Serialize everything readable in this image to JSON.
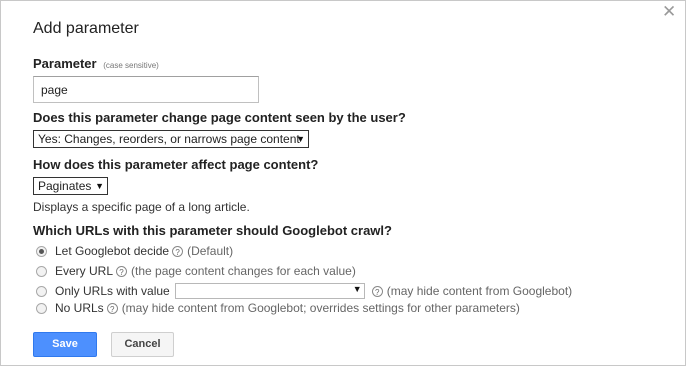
{
  "dialog": {
    "title": "Add parameter",
    "close_glyph": "✕"
  },
  "parameter": {
    "label": "Parameter",
    "hint": "(case sensitive)",
    "value": "page"
  },
  "change_question": {
    "text": "Does this parameter change page content seen by the user?",
    "selected": "Yes: Changes, reorders, or narrows page content"
  },
  "effect_question": {
    "text": "How does this parameter affect page content?",
    "selected": "Paginates",
    "description": "Displays a specific page of a long article."
  },
  "crawl_question": {
    "text": "Which URLs with this parameter should Googlebot crawl?",
    "options": [
      {
        "label": "Let Googlebot decide",
        "note": "(Default)",
        "checked": true
      },
      {
        "label": "Every URL",
        "note": "(the page content changes for each value)",
        "checked": false
      },
      {
        "label": "Only URLs with value",
        "note": "(may hide content from Googlebot)",
        "checked": false
      },
      {
        "label": "No URLs",
        "note": "(may hide content from Googlebot; overrides settings for other parameters)",
        "checked": false
      }
    ]
  },
  "help_glyph": "?",
  "dropdown_arrow": "▼",
  "buttons": {
    "save": "Save",
    "cancel": "Cancel"
  },
  "colors": {
    "primary_button": "#4d90fe",
    "secondary_button": "#f5f5f5"
  }
}
